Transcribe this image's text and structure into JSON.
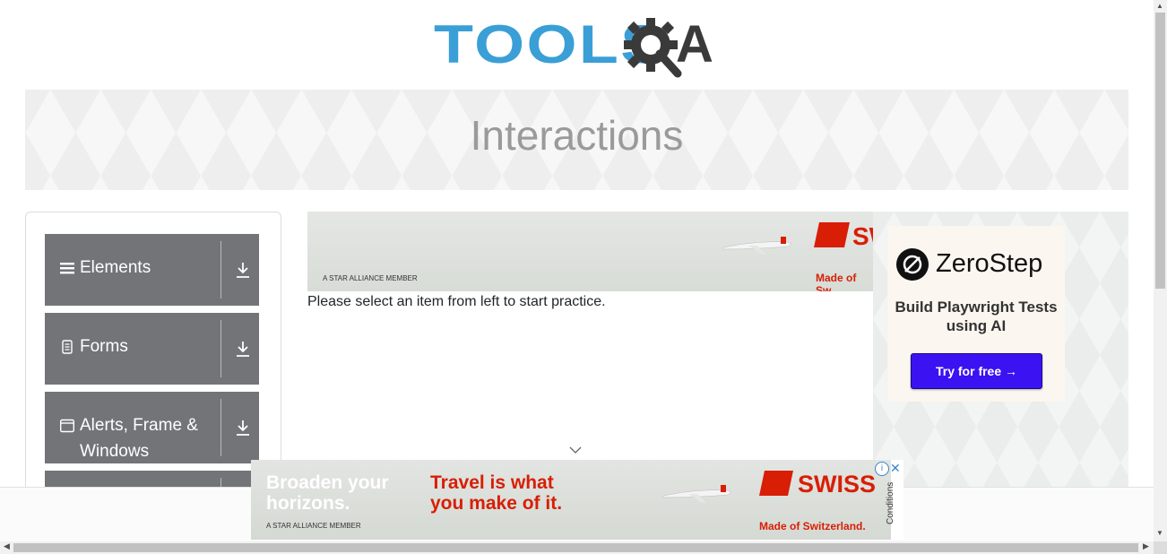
{
  "header": {
    "logo_tools": "TOOLS",
    "logo_qa": "A"
  },
  "banner": {
    "title": "Interactions"
  },
  "sidebar": {
    "groups": [
      {
        "label": "Elements",
        "icon": "hamburger-icon"
      },
      {
        "label": "Forms",
        "icon": "document-icon"
      },
      {
        "label": "Alerts, Frame & Windows",
        "icon": "window-icon"
      },
      {
        "label": "",
        "icon": ""
      }
    ]
  },
  "main": {
    "instruction": "Please select an item from left to start practice."
  },
  "ad_top": {
    "brand": "SW",
    "member": "A STAR ALLIANCE MEMBER",
    "made": "Made of Sw"
  },
  "right_ad": {
    "brand": "ZeroStep",
    "tagline": "Build Playwright Tests using AI",
    "cta": "Try for free →"
  },
  "ad_bottom": {
    "headline_left": "Broaden your horizons.",
    "headline_mid": "Travel is what you make of it.",
    "brand": "SWISS",
    "member": "A STAR ALLIANCE MEMBER",
    "made": "Made of Switzerland.",
    "adchoices": "i",
    "close": "✕",
    "conditions": "Conditions"
  },
  "colors": {
    "menu_bg": "#727478",
    "logo_blue": "#3a9fd6",
    "swiss_red": "#d81e05",
    "cta_bg": "#3b12f2"
  }
}
